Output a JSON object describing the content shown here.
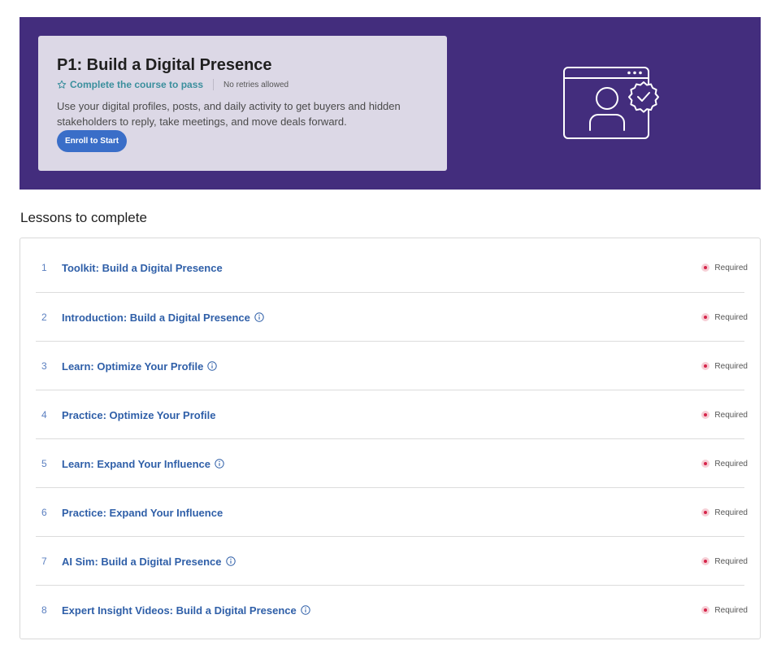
{
  "course": {
    "title": "P1: Build a Digital Presence",
    "pass_label": "Complete the course to pass",
    "retries_label": "No retries allowed",
    "description": "Use your digital profiles, posts, and daily activity to get buyers and hidden stakeholders to reply, take meetings, and move deals forward.",
    "enroll_label": "Enroll to Start",
    "illustration_icon": "profile-badge-icon"
  },
  "colors": {
    "hero_bg": "#432d7d",
    "card_bg": "#dcd8e6",
    "accent_blue": "#3a6ec8",
    "pass_teal": "#3b8f9d",
    "required_red": "#d6244a"
  },
  "lessons_section": {
    "title": "Lessons to complete",
    "required_label": "Required",
    "items": [
      {
        "num": "1",
        "title": "Toolkit: Build a Digital Presence",
        "info": false
      },
      {
        "num": "2",
        "title": "Introduction: Build a Digital Presence",
        "info": true
      },
      {
        "num": "3",
        "title": "Learn: Optimize Your Profile",
        "info": true
      },
      {
        "num": "4",
        "title": "Practice: Optimize Your Profile",
        "info": false
      },
      {
        "num": "5",
        "title": "Learn: Expand Your Influence",
        "info": true
      },
      {
        "num": "6",
        "title": "Practice: Expand Your Influence",
        "info": false
      },
      {
        "num": "7",
        "title": "AI Sim: Build a Digital Presence",
        "info": true
      },
      {
        "num": "8",
        "title": "Expert Insight Videos: Build a Digital Presence",
        "info": true
      }
    ]
  }
}
